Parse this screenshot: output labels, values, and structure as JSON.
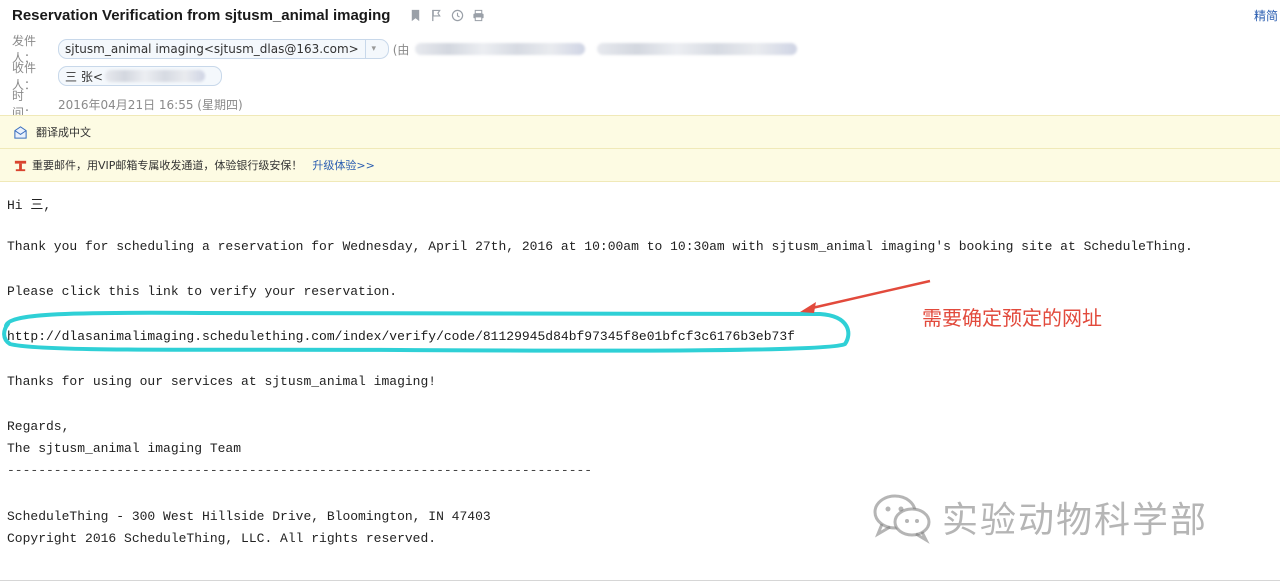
{
  "header": {
    "subject": "Reservation Verification from sjtusm_animal imaging",
    "top_right_link": "精简",
    "from": {
      "label": "发件人：",
      "address": "sjtusm_animal imaging<sjtusm_dlas@163.com>",
      "via": "(由"
    },
    "to": {
      "label": "收件人：",
      "address": "三 张<"
    },
    "time": {
      "label": "时　间：",
      "value": "2016年04月21日 16:55 (星期四)"
    }
  },
  "notices": {
    "translate_label": "翻译成中文",
    "vip_text": "重要邮件，用VIP邮箱专属收发通道，体验银行级安保！",
    "vip_link": "升级体验>>"
  },
  "body": {
    "greeting": "Hi 三,",
    "thanks": "Thank you for scheduling a reservation for Wednesday, April 27th, 2016 at 10:00am to 10:30am with sjtusm_animal imaging's booking site at ScheduleThing.",
    "instruction": "Please click this link to verify your reservation.",
    "verify_link": "http://dlasanimalimaging.schedulething.com/index/verify/code/81129945d84bf97345f8e01bfcf3c6176b3eb73f",
    "thanks_using": "Thanks for using our services at sjtusm_animal imaging!",
    "regards": "Regards,",
    "team": "The sjtusm_animal imaging Team",
    "separator": "---------------------------------------------------------------------------",
    "address": "ScheduleThing - 300 West Hillside Drive, Bloomington, IN 47403",
    "copyright": "Copyright 2016 ScheduleThing, LLC. All rights reserved."
  },
  "annotation": {
    "text": "需要确定预定的网址",
    "color": "#e24a3c",
    "highlight_color": "#2fd0d6"
  },
  "watermark": {
    "text": "实验动物科学部"
  },
  "icons": [
    "bookmark-icon",
    "flag-icon",
    "clock-icon",
    "print-icon",
    "translate-icon",
    "vip-mail-icon",
    "wechat-icon"
  ]
}
